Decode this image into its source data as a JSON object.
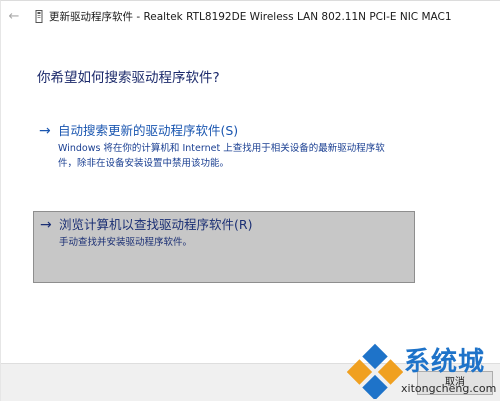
{
  "titlebar": {
    "title": "更新驱动程序软件 - Realtek RTL8192DE Wireless LAN 802.11N PCI-E NIC MAC1",
    "back_icon": "back-arrow-icon",
    "device_icon": "network-adapter-icon"
  },
  "heading": "你希望如何搜索驱动程序软件?",
  "options": [
    {
      "arrow": "→",
      "title": "自动搜索更新的驱动程序软件(S)",
      "desc_line1": "Windows 将在你的计算机和 Internet 上查找用于相关设备的最新驱动程序软",
      "desc_line2": "件，除非在设备安装设置中禁用该功能。"
    },
    {
      "arrow": "→",
      "title": "浏览计算机以查找驱动程序软件(R)",
      "desc_line1": "手动查找并安装驱动程序软件。",
      "selected": true
    }
  ],
  "footer": {
    "cancel_label": "取消"
  },
  "watermark": {
    "name": "系统城",
    "url": "xitongcheng.com"
  },
  "colors": {
    "link_blue": "#1a56b0",
    "heading_navy": "#1c2a6b",
    "selected_bg": "#c7c7c7",
    "watermark_blue": "#1e73c9"
  }
}
